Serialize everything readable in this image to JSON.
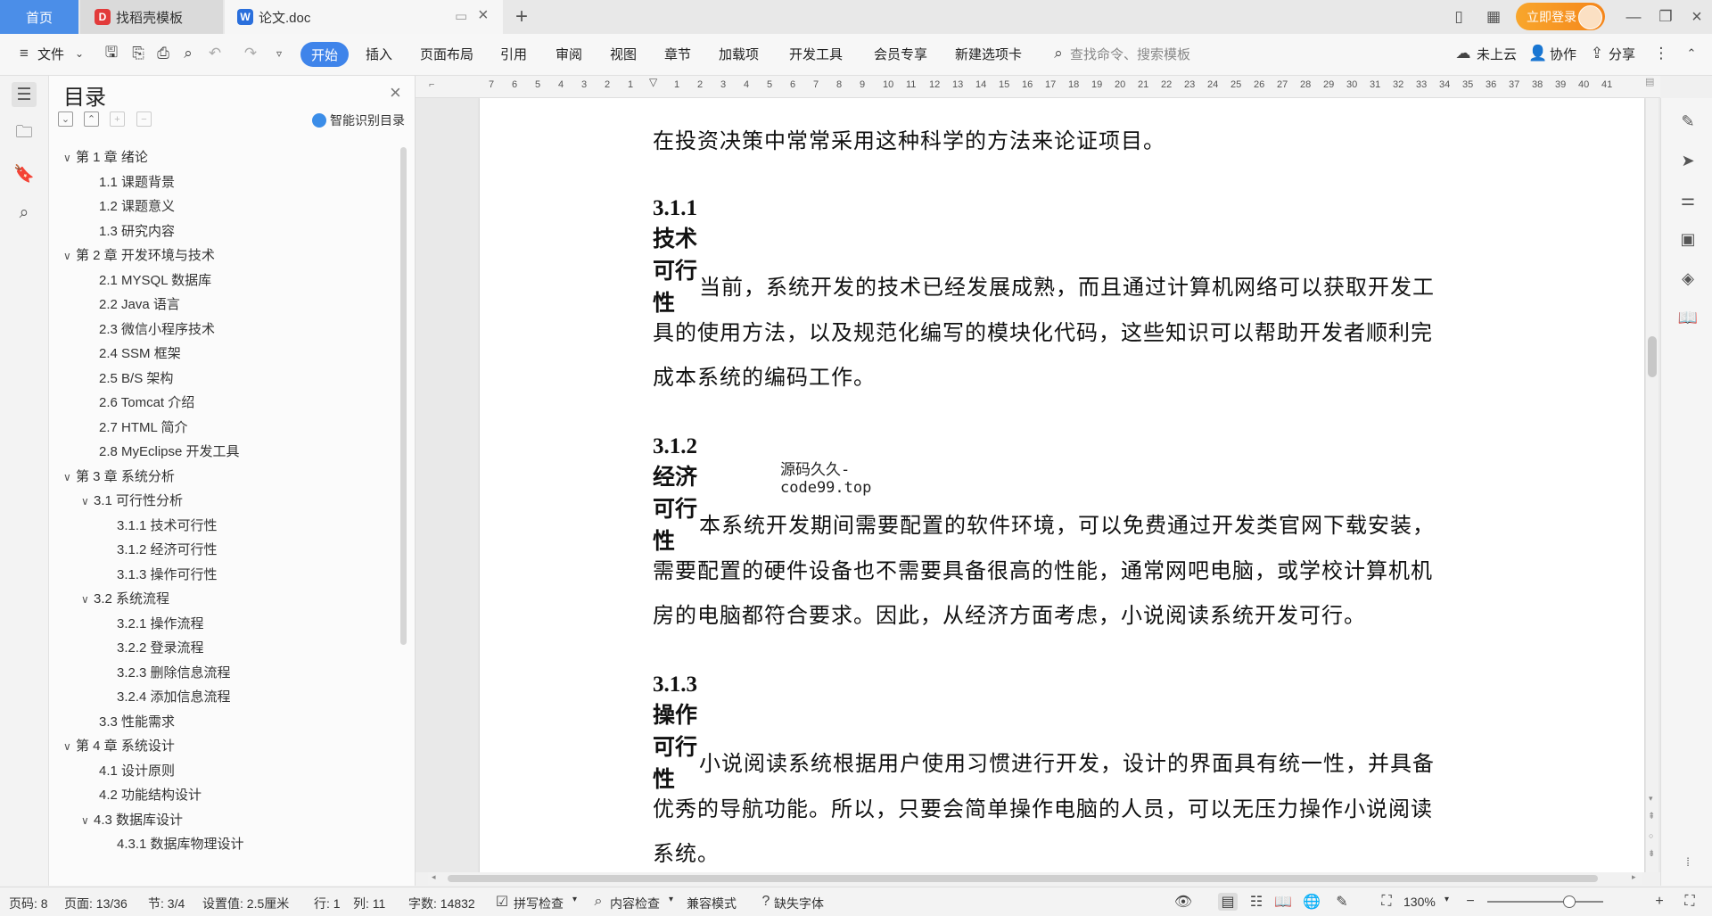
{
  "tabs": {
    "home": "首页",
    "template": "找稻壳模板",
    "document": "论文.doc"
  },
  "titlebar": {
    "login": "立即登录"
  },
  "menu": {
    "file": "文件",
    "items": [
      "开始",
      "插入",
      "页面布局",
      "引用",
      "审阅",
      "视图",
      "章节",
      "加载项",
      "开发工具",
      "会员专享",
      "新建选项卡"
    ],
    "search_placeholder": "查找命令、搜索模板",
    "cloud": "未上云",
    "collab": "协作",
    "share": "分享"
  },
  "toc": {
    "title": "目录",
    "smart": "智能识别目录",
    "items": [
      {
        "level": 1,
        "text": "第 1 章  绪论",
        "expanded": true
      },
      {
        "level": 2,
        "text": "1.1  课题背景"
      },
      {
        "level": 2,
        "text": "1.2  课题意义"
      },
      {
        "level": 2,
        "text": "1.3  研究内容"
      },
      {
        "level": 1,
        "text": "第 2 章  开发环境与技术",
        "expanded": true
      },
      {
        "level": 2,
        "text": "2.1  MYSQL 数据库"
      },
      {
        "level": 2,
        "text": "2.2  Java 语言"
      },
      {
        "level": 2,
        "text": "2.3  微信小程序技术"
      },
      {
        "level": 2,
        "text": "2.4  SSM 框架"
      },
      {
        "level": 2,
        "text": "2.5  B/S 架构"
      },
      {
        "level": 2,
        "text": "2.6  Tomcat  介绍"
      },
      {
        "level": 2,
        "text": "2.7  HTML 简介"
      },
      {
        "level": 2,
        "text": "2.8  MyEclipse 开发工具"
      },
      {
        "level": 1,
        "text": "第 3 章  系统分析",
        "expanded": true
      },
      {
        "level": 2,
        "text": "3.1  可行性分析",
        "expanded": true
      },
      {
        "level": 3,
        "text": "3.1.1  技术可行性"
      },
      {
        "level": 3,
        "text": "3.1.2  经济可行性"
      },
      {
        "level": 3,
        "text": "3.1.3  操作可行性"
      },
      {
        "level": 2,
        "text": "3.2  系统流程",
        "expanded": true
      },
      {
        "level": 3,
        "text": "3.2.1  操作流程"
      },
      {
        "level": 3,
        "text": "3.2.2  登录流程"
      },
      {
        "level": 3,
        "text": "3.2.3  删除信息流程"
      },
      {
        "level": 3,
        "text": "3.2.4  添加信息流程"
      },
      {
        "level": 2,
        "text": "3.3  性能需求"
      },
      {
        "level": 1,
        "text": "第 4 章  系统设计",
        "expanded": true
      },
      {
        "level": 2,
        "text": "4.1  设计原则"
      },
      {
        "level": 2,
        "text": "4.2  功能结构设计"
      },
      {
        "level": 2,
        "text": "4.3  数据库设计",
        "expanded": true
      },
      {
        "level": 3,
        "text": "4.3.1  数据库物理设计"
      }
    ]
  },
  "ruler": {
    "ticks": [
      "7",
      "6",
      "5",
      "4",
      "3",
      "2",
      "1",
      "",
      "1",
      "2",
      "3",
      "4",
      "5",
      "6",
      "7",
      "8",
      "9",
      "10",
      "11",
      "12",
      "13",
      "14",
      "15",
      "16",
      "17",
      "18",
      "19",
      "20",
      "21",
      "22",
      "23",
      "24",
      "25",
      "26",
      "27",
      "28",
      "29",
      "30",
      "31",
      "32",
      "33",
      "34",
      "35",
      "36",
      "37",
      "38",
      "39",
      "40",
      "41"
    ]
  },
  "document": {
    "line_top": "在投资决策中常常采用这种科学的方法来论证项目。",
    "h1": "3.1.1  技术可行性",
    "p1": [
      "当前，系统开发的技术已经发展成熟，而且通过计算机网络可以获取开发工",
      "具的使用方法，以及规范化编写的模块化代码，这些知识可以帮助开发者顺利完",
      "成本系统的编码工作。"
    ],
    "h2": "3.1.2  经济可行性",
    "watermark": "源码久久-code99.top",
    "p2": [
      "本系统开发期间需要配置的软件环境，可以免费通过开发类官网下载安装，",
      "需要配置的硬件设备也不需要具备很高的性能，通常网吧电脑，或学校计算机机",
      "房的电脑都符合要求。因此，从经济方面考虑，小说阅读系统开发可行。"
    ],
    "h3": "3.1.3  操作可行性",
    "p3": [
      "小说阅读系统根据用户使用习惯进行开发，设计的界面具有统一性，并具备",
      "优秀的导航功能。所以，只要会简单操作电脑的人员，可以无压力操作小说阅读",
      "系统。"
    ]
  },
  "status": {
    "page_code": "页码: 8",
    "page": "页面: 13/36",
    "section": "节: 3/4",
    "setting": "设置值: 2.5厘米",
    "row": "行: 1",
    "col": "列: 11",
    "words": "字数: 14832",
    "spell": "拼写检查",
    "content_check": "内容检查",
    "compat": "兼容模式",
    "missing_font": "缺失字体",
    "zoom": "130%"
  }
}
